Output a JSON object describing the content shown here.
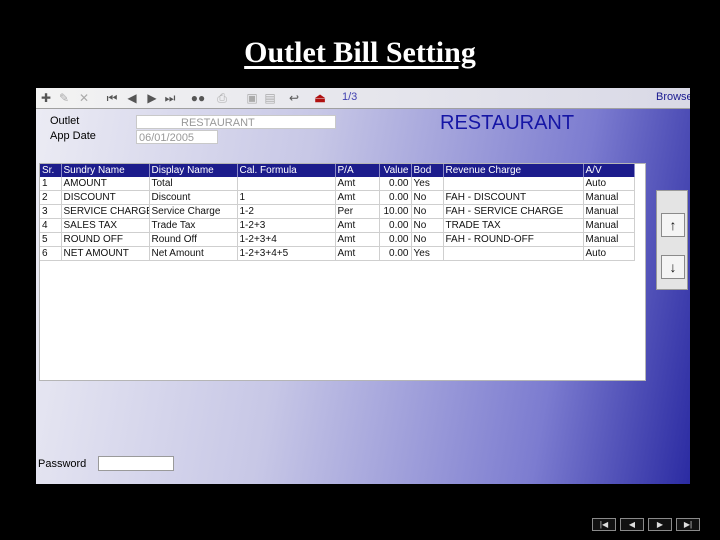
{
  "slide": {
    "title": "Outlet Bill Setting"
  },
  "toolbar": {
    "record_indicator": "1/3",
    "mode_label": "Browse",
    "icons": [
      "add-icon",
      "edit-icon",
      "delete-icon",
      "first-record-icon",
      "previous-record-icon",
      "next-record-icon",
      "last-record-icon",
      "binoculars-icon",
      "print-icon",
      "save-icon",
      "save-all-icon",
      "undo-icon",
      "exit-icon"
    ]
  },
  "form": {
    "outlet_label": "Outlet",
    "outlet_value": "RESTAURANT",
    "app_date_label": "App Date",
    "app_date_value": "06/01/2005",
    "outlet_display_name": "RESTAURANT"
  },
  "grid": {
    "columns": [
      "Sr.",
      "Sundry Name",
      "Display Name",
      "Cal. Formula",
      "P/A",
      "Value",
      "Bod",
      "Revenue Charge",
      "A/V"
    ],
    "rows": [
      [
        "1",
        "AMOUNT",
        "Total",
        "",
        "Amt",
        "0.00",
        "Yes",
        "",
        "Auto"
      ],
      [
        "2",
        "DISCOUNT",
        "Discount",
        "1",
        "Amt",
        "0.00",
        "No",
        "FAH - DISCOUNT",
        "Manual"
      ],
      [
        "3",
        "SERVICE CHARGE",
        "Service Charge",
        "1-2",
        "Per",
        "10.00",
        "No",
        "FAH - SERVICE CHARGE",
        "Manual"
      ],
      [
        "4",
        "SALES TAX",
        "Trade Tax",
        "1-2+3",
        "Amt",
        "0.00",
        "No",
        "TRADE TAX",
        "Manual"
      ],
      [
        "5",
        "ROUND OFF",
        "Round Off",
        "1-2+3+4",
        "Amt",
        "0.00",
        "No",
        "FAH - ROUND-OFF",
        "Manual"
      ],
      [
        "6",
        "NET AMOUNT",
        "Net Amount",
        "1-2+3+4+5",
        "Amt",
        "0.00",
        "Yes",
        "",
        "Auto"
      ]
    ]
  },
  "side_buttons": {
    "up_glyph": "↑",
    "down_glyph": "↓"
  },
  "password": {
    "label": "Password",
    "value": ""
  },
  "slide_nav": {
    "first": "|◀",
    "prev": "◀",
    "next": "▶",
    "last": "▶|"
  },
  "colors": {
    "header_bg": "#1c1c8c",
    "title_text": "#1515a5",
    "slide_bg": "#000000"
  }
}
